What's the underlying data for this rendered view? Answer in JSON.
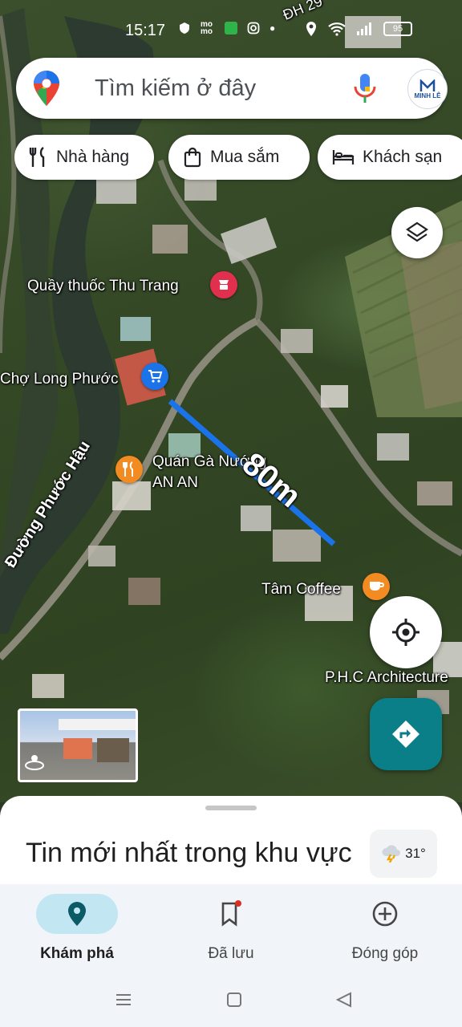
{
  "status_bar": {
    "time": "15:17",
    "momo": "mo mo",
    "battery": "95"
  },
  "search": {
    "placeholder": "Tìm kiếm ở đây",
    "avatar_text": "MINH LÊ"
  },
  "chips": [
    {
      "label": "Nhà hàng",
      "icon": "restaurant-icon"
    },
    {
      "label": "Mua sắm",
      "icon": "shopping-bag-icon"
    },
    {
      "label": "Khách sạn",
      "icon": "hotel-icon"
    }
  ],
  "map": {
    "road_dh": "ĐH 29",
    "places": {
      "pharmacy": "Quầy thuốc Thu Trang",
      "market": "Chợ Long Phước",
      "restaurant_line1": "Quán Gà Nướng",
      "restaurant_line2": "AN AN",
      "coffee": "Tâm Coffee",
      "architecture": "P.H.C Architecture",
      "street": "Đường Phước Hậu"
    },
    "measure_label": "80m",
    "colors": {
      "measure_line": "#1a73e8",
      "pharmacy_pin": "#e0304e",
      "shop_pin": "#1a73e8",
      "food_pin": "#f28b22"
    }
  },
  "sheet": {
    "news_title": "Tin mới nhất trong khu vực",
    "temperature": "31°"
  },
  "bottom_nav": [
    {
      "label": "Khám phá",
      "icon": "explore-pin-icon",
      "active": true
    },
    {
      "label": "Đã lưu",
      "icon": "bookmark-icon",
      "active": false
    },
    {
      "label": "Đóng góp",
      "icon": "add-circle-icon",
      "active": false
    }
  ],
  "colors": {
    "accent": "#0b7f88",
    "active_nav": "#c2e7f3"
  }
}
